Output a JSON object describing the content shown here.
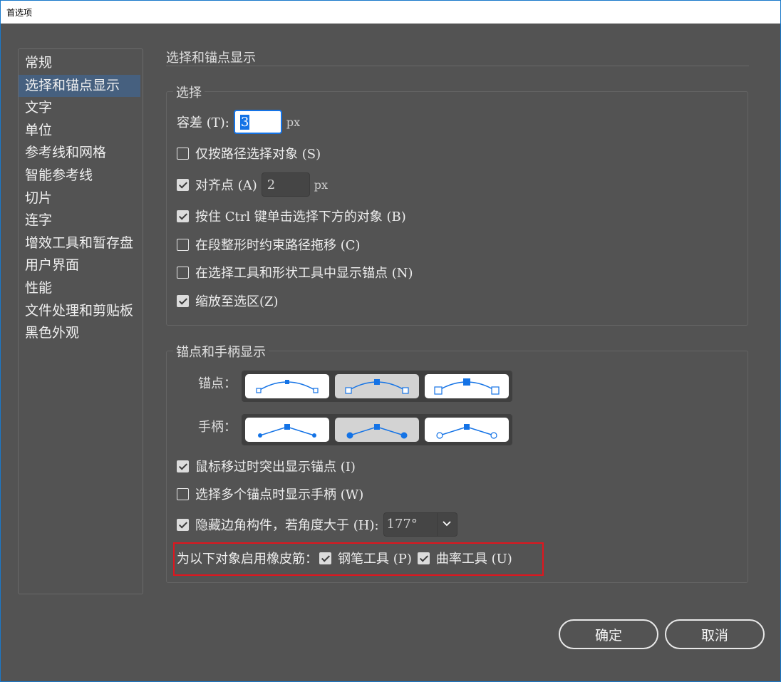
{
  "window": {
    "title": "首选项"
  },
  "sidebar": {
    "items": [
      {
        "label": "常规"
      },
      {
        "label": "选择和锚点显示"
      },
      {
        "label": "文字"
      },
      {
        "label": "单位"
      },
      {
        "label": "参考线和网格"
      },
      {
        "label": "智能参考线"
      },
      {
        "label": "切片"
      },
      {
        "label": "连字"
      },
      {
        "label": "增效工具和暂存盘"
      },
      {
        "label": "用户界面"
      },
      {
        "label": "性能"
      },
      {
        "label": "文件处理和剪贴板"
      },
      {
        "label": "黑色外观"
      }
    ],
    "active_index": 1
  },
  "main": {
    "title": "选择和锚点显示",
    "selection": {
      "group_title": "选择",
      "tolerance_label": "容差 (T):",
      "tolerance_value": "3",
      "tolerance_unit": "px",
      "object_by_path": {
        "label": "仅按路径选择对象 (S)",
        "checked": false
      },
      "snap_to_point": {
        "label": "对齐点 (A)",
        "checked": true,
        "value": "2",
        "unit": "px"
      },
      "ctrl_click": {
        "label": "按住 Ctrl 键单击选择下方的对象 (B)",
        "checked": true
      },
      "constrain_path": {
        "label": "在段整形时约束路径拖移 (C)",
        "checked": false
      },
      "show_anchor": {
        "label": "在选择工具和形状工具中显示锚点 (N)",
        "checked": false
      },
      "zoom_to_selection": {
        "label": "缩放至选区(Z)",
        "checked": true
      }
    },
    "anchor_display": {
      "group_title": "锚点和手柄显示",
      "anchors_label": "锚点：",
      "handles_label": "手柄：",
      "anchors_selected": 1,
      "handles_selected": 1,
      "highlight_anchors": {
        "label": "鼠标移过时突出显示锚点 (I)",
        "checked": true
      },
      "show_handles_multi": {
        "label": "选择多个锚点时显示手柄 (W)",
        "checked": false
      },
      "hide_corner_widget": {
        "label": "隐藏边角构件，若角度大于 (H):",
        "checked": true,
        "value": "177°"
      },
      "rubber_band_label": "为以下对象启用橡皮筋：",
      "pen_tool": {
        "label": "钢笔工具 (P)",
        "checked": true
      },
      "curvature_tool": {
        "label": "曲率工具 (U)",
        "checked": true
      }
    }
  },
  "footer": {
    "ok_label": "确定",
    "cancel_label": "取消"
  },
  "colors": {
    "accent": "#1473e6",
    "highlight": "#e0151e",
    "sidebar_active": "#46607f",
    "background": "#535353"
  },
  "icons": {
    "dropdown": "chevron-down-icon",
    "check": "check-icon"
  }
}
